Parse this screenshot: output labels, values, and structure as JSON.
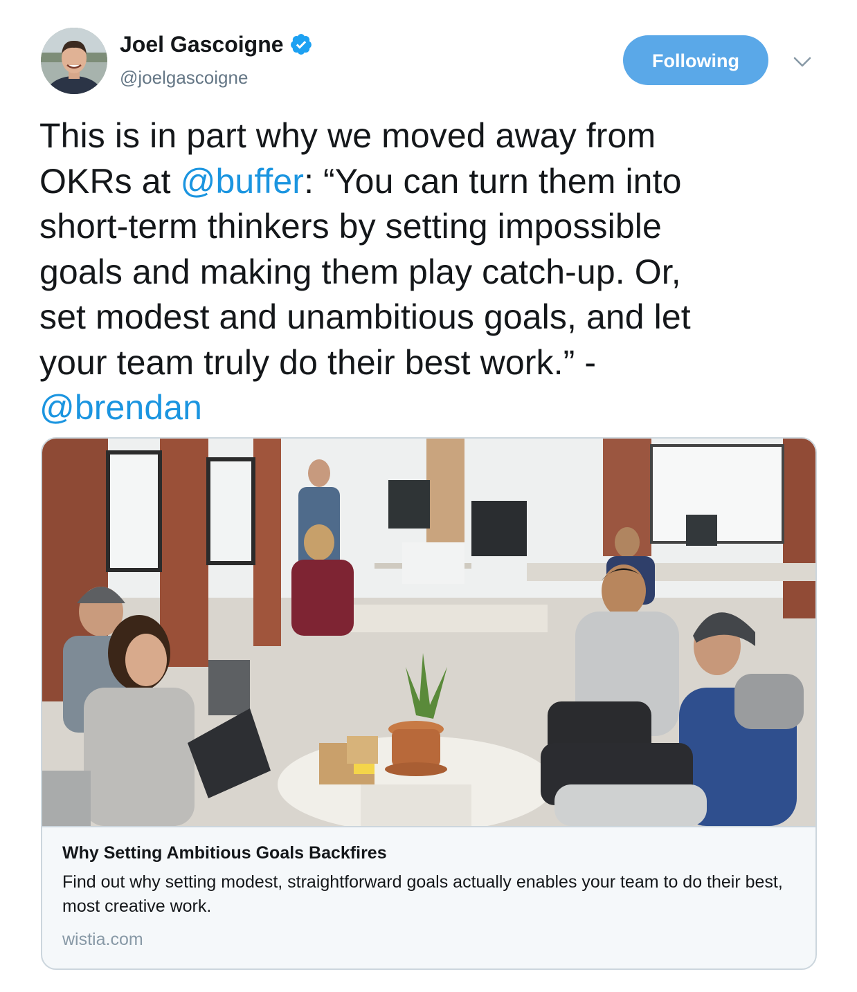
{
  "user": {
    "display_name": "Joel Gascoigne",
    "handle": "@joelgascoigne",
    "verified_icon": "verified-badge-icon",
    "avatar": "avatar-photo"
  },
  "actions": {
    "follow_label": "Following",
    "menu_icon": "chevron-down-icon"
  },
  "tweet": {
    "line1": "This is in part why we moved away from",
    "line2_pre": "OKRs at ",
    "line2_mention": "@buffer",
    "line2_post": ": “You can turn them into",
    "line3": "short-term thinkers by setting impossible",
    "line4": "goals and making them play catch-up. Or,",
    "line5": "set modest and unambitious goals, and let",
    "line6": "your team truly do their best work.” -",
    "line7_mention": "@brendan"
  },
  "card": {
    "image": "office-team-photo",
    "title": "Why Setting Ambitious Goals Backfires",
    "description": "Find out why setting modest, straightforward goals actually enables your team to do their best, most creative work.",
    "domain": "wistia.com"
  },
  "colors": {
    "accent": "#1b95e0",
    "follow_button": "#5aa8e8",
    "card_background": "#f5f8fa",
    "border": "#ccd6dd",
    "secondary_text": "#657786"
  }
}
